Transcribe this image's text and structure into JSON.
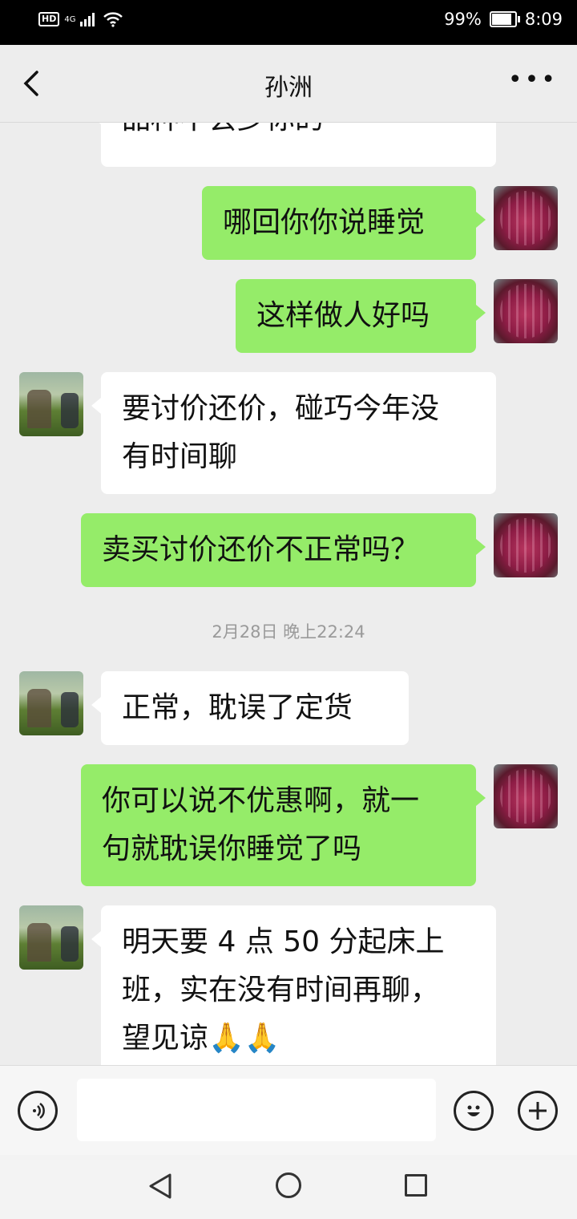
{
  "status_bar": {
    "hd": "HD",
    "network": "4G",
    "battery_percent": "99%",
    "battery_level": 0.99,
    "time": "8:09"
  },
  "header": {
    "title": "孙洲",
    "back_icon": "chevron-left-icon",
    "more_icon": "more-icon"
  },
  "messages": [
    {
      "from": "them",
      "text": "品种不会少你的"
    },
    {
      "from": "me",
      "text": "哪回你你说睡觉"
    },
    {
      "from": "me",
      "text": "这样做人好吗"
    },
    {
      "from": "them",
      "text": "要讨价还价，碰巧今年没\n有时间聊"
    },
    {
      "from": "me",
      "text": "卖买讨价还价不正常吗？"
    },
    {
      "from": "them",
      "text": "正常，耽误了定货"
    },
    {
      "from": "me",
      "text": "你可以说不优惠啊，就一\n句就耽误你睡觉了吗"
    },
    {
      "from": "them",
      "text": "明天要 4 点 50 分起床上\n班，实在没有时间再聊，\n望见谅🙏🙏"
    }
  ],
  "timestamp": "2月28日 晚上22:24",
  "input_bar": {
    "voice_icon": "voice-icon",
    "emoji_icon": "emoji-icon",
    "plus_icon": "plus-icon",
    "input_value": ""
  },
  "system_nav": {
    "back_icon": "nav-back-icon",
    "home_icon": "nav-home-icon",
    "recent_icon": "nav-recent-icon"
  }
}
